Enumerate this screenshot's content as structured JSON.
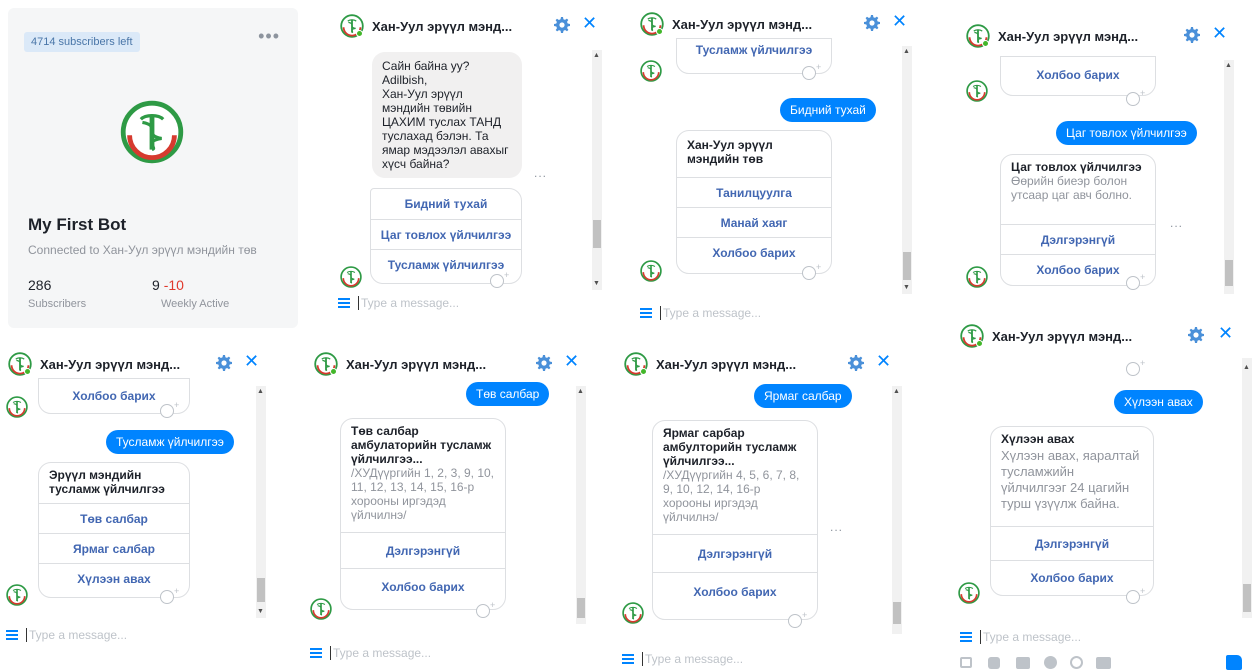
{
  "bot": {
    "subscribers_left": "4714 subscribers left",
    "more": "•••",
    "name": "My First Bot",
    "connected": "Connected to Хан-Уул эрүүл мэндийн төв",
    "subscribers_value": "286",
    "subscribers_label": "Subscribers",
    "weekly_value": "9",
    "weekly_delta": "-10",
    "weekly_label": "Weekly Active"
  },
  "chat_title": "Хан-Уул эрүүл мэнд...",
  "placeholder": "Type a message...",
  "dots": "...",
  "brand_color": "#0084ff",
  "accent_green": "#42b72a",
  "panels": {
    "p1": {
      "greeting": "Сайн байна уу?\nAdilbish,\nХан-Уул эрүүл мэндийн төвийн ЦАХИМ туслах ТАНД туслахад бэлэн. Та ямар мэдээлэл авахыг хүсч байна?",
      "buttons": [
        "Бидний тухай",
        "Цаг товлох үйлчилгээ",
        "Тусламж үйлчилгээ"
      ]
    },
    "p2": {
      "top_button": "Тусламж үйлчилгээ",
      "user_msg": "Бидний тухай",
      "card_title": "Хан-Уул эрүүл мэндийн төв",
      "buttons": [
        "Танилцуулга",
        "Манай хаяг",
        "Холбоо барих"
      ]
    },
    "p3": {
      "top_button": "Холбоо барих",
      "user_msg": "Цаг товлох үйлчилгээ",
      "card_title": "Цаг товлох үйлчилгээ",
      "card_desc": "Өөрийн биеэр болон утсаар цаг авч болно.",
      "buttons": [
        "Дэлгэрэнгүй",
        "Холбоо барих"
      ]
    },
    "p4": {
      "top_button": "Холбоо барих",
      "user_msg": "Тусламж үйлчилгээ",
      "card_title": "Эрүүл мэндийн тусламж үйлчилгээ",
      "buttons": [
        "Төв салбар",
        "Ярмаг салбар",
        "Хүлээн авах"
      ]
    },
    "p5": {
      "user_msg": "Төв салбар",
      "card_title": "Төв салбар амбулаторийн тусламж үйлчилгээ...",
      "card_desc": "/ХУДүүргийн 1, 2, 3, 9, 10, 11, 12, 13, 14, 15, 16-р хорооны иргэдэд үйлчилнэ/",
      "buttons": [
        "Дэлгэрэнгүй",
        "Холбоо барих"
      ]
    },
    "p6": {
      "user_msg": "Ярмаг салбар",
      "card_title": "Ярмаг сарбар амбулторийн тусламж үйлчилгээ...",
      "card_desc": "/ХУДүүргийн 4, 5, 6, 7, 8, 9, 10, 12, 14, 16-р хорооны иргэдэд үйлчилнэ/",
      "buttons": [
        "Дэлгэрэнгүй",
        "Холбоо барих"
      ]
    },
    "p7": {
      "user_msg": "Хүлээн авах",
      "card_title": "Хүлээн авах",
      "card_desc": "Хүлээн авах, яаралтай тусламжийн үйлчилгээг 24 цагийн турш үзүүлж байна.",
      "buttons": [
        "Дэлгэрэнгүй",
        "Холбоо барих"
      ]
    }
  }
}
